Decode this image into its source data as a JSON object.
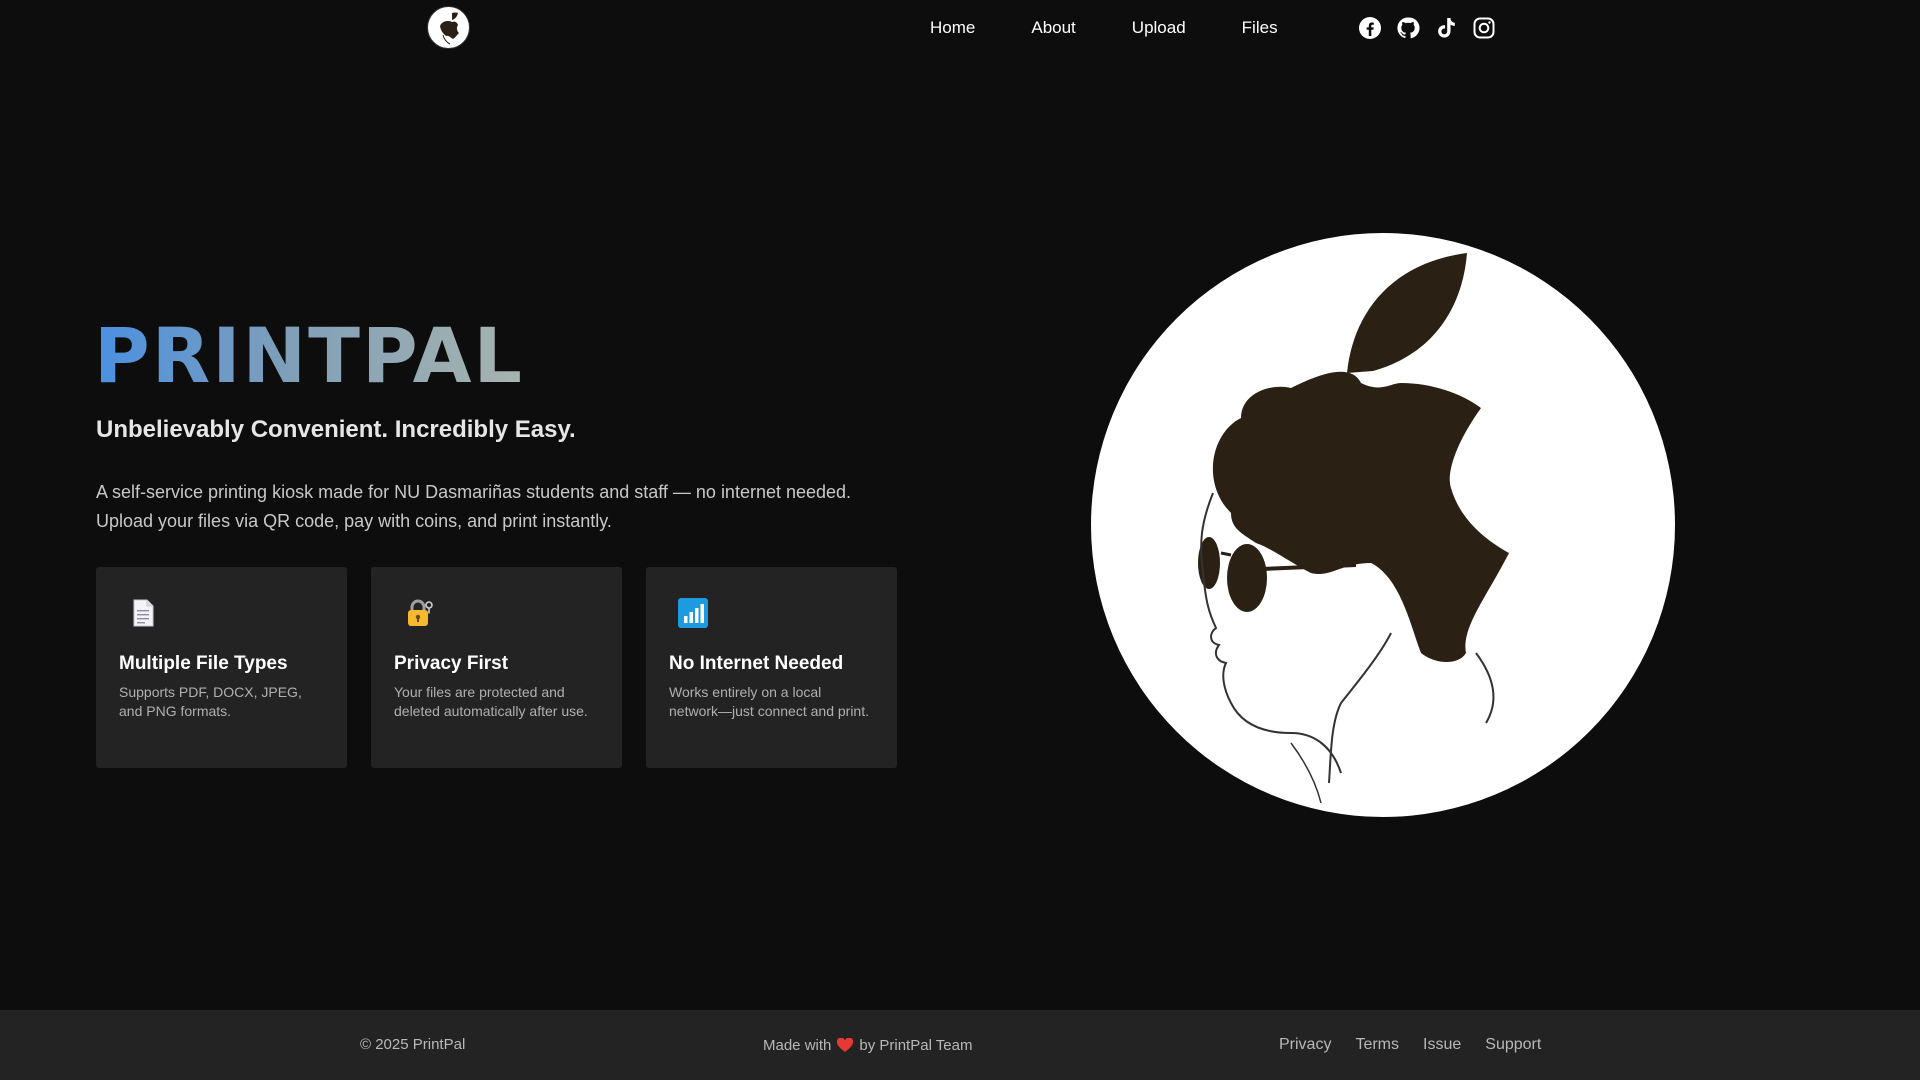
{
  "nav": {
    "logo_icon": "printpal-logo-icon",
    "links": [
      {
        "label": "Home"
      },
      {
        "label": "About"
      },
      {
        "label": "Upload"
      },
      {
        "label": "Files"
      }
    ],
    "social": [
      "facebook-icon",
      "github-icon",
      "tiktok-icon",
      "instagram-icon"
    ]
  },
  "hero": {
    "title": "PRINTPAL",
    "subtitle": "Unbelievably Convenient. Incredibly Easy.",
    "description": "A self-service printing kiosk made for NU Dasmariñas students and staff — no internet needed. Upload your files via QR code, pay with coins, and print instantly.",
    "features": [
      {
        "icon": "document-icon",
        "title": "Multiple File Types",
        "desc": "Supports PDF, DOCX, JPEG, and PNG formats."
      },
      {
        "icon": "lock-key-icon",
        "title": "Privacy First",
        "desc": "Your files are protected and deleted automatically after use."
      },
      {
        "icon": "signal-bars-icon",
        "title": "No Internet Needed",
        "desc": "Works entirely on a local network—just connect and print."
      }
    ],
    "illustration_icon": "mascot-portrait-icon"
  },
  "footer": {
    "copyright": "© 2025 PrintPal",
    "made_prefix": "Made with",
    "made_suffix": "by PrintPal Team",
    "heart_icon": "heart-icon",
    "links": [
      {
        "label": "Privacy"
      },
      {
        "label": "Terms"
      },
      {
        "label": "Issue"
      },
      {
        "label": "Support"
      }
    ]
  },
  "colors": {
    "background": "#0d0d0d",
    "card": "#232323",
    "title_gradient_start": "#4a90e2",
    "title_gradient_end": "#a8b4ae",
    "heart": "#e53935"
  }
}
